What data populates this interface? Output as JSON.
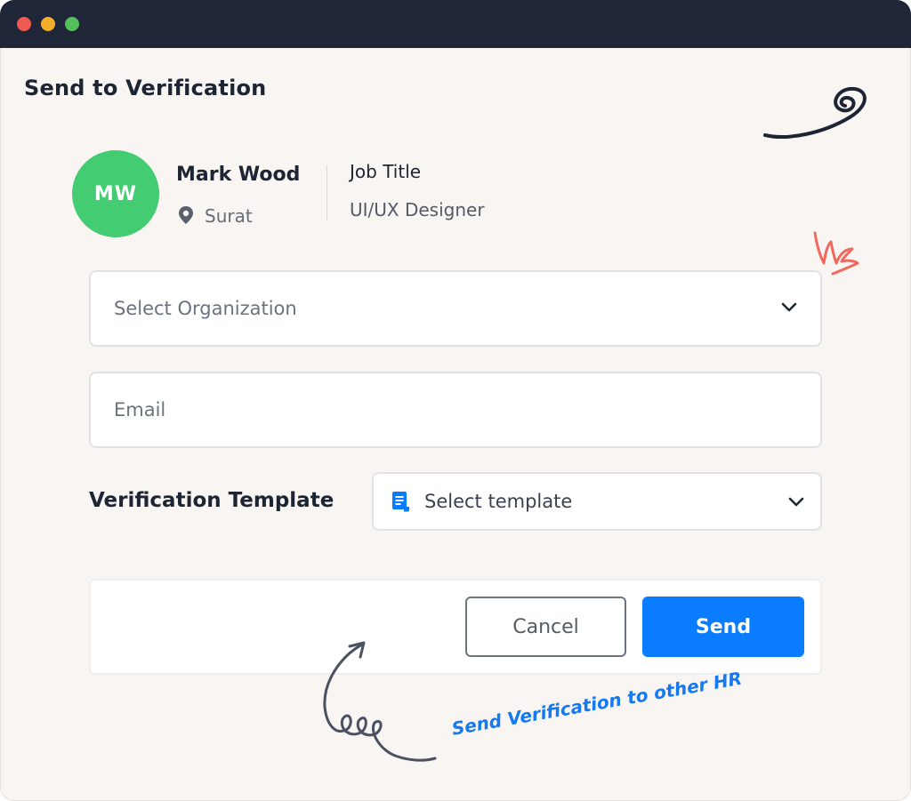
{
  "window": {
    "controls": [
      "close",
      "minimize",
      "maximize"
    ],
    "colors": {
      "titlebar": "#1f2638",
      "background": "#f8f5f2",
      "close": "#f05a52",
      "minimize": "#f5ad2c",
      "maximize": "#55bf5b"
    }
  },
  "page": {
    "title": "Send to Verification"
  },
  "candidate": {
    "initials": "MW",
    "name": "Mark Wood",
    "location_icon": "location-pin-icon",
    "location": "Surat",
    "job_label": "Job Title",
    "job_value": "UI/UX Designer",
    "avatar_color": "#44cc73"
  },
  "form": {
    "organization": {
      "placeholder": "Select Organization",
      "icon": "chevron-down-icon"
    },
    "email": {
      "placeholder": "Email"
    },
    "template": {
      "label": "Verification Template",
      "placeholder": "Select template",
      "icon": "document-icon",
      "dropdown_icon": "chevron-down-icon"
    }
  },
  "actions": {
    "cancel_label": "Cancel",
    "send_label": "Send",
    "send_color": "#0a7cff"
  },
  "annotation": {
    "text": "Send Verification to other HR",
    "color": "#1479f2"
  }
}
